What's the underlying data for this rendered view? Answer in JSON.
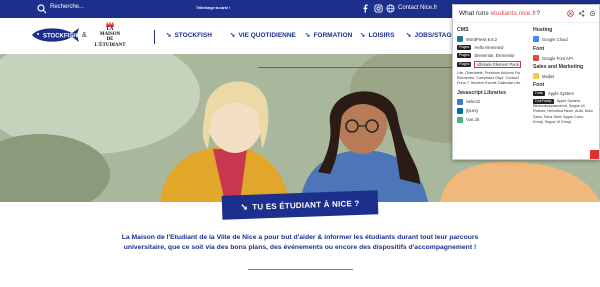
{
  "topbar": {
    "search_label": "Recherche...",
    "promo": "Télécharge ta carte !",
    "contact": "Contact",
    "nicefr": "Nice.fr"
  },
  "header": {
    "logo_fish_text": "STOCKFISH",
    "logo_amp": "&",
    "logo_maison_lines": [
      "LA",
      "MAISON",
      "DE",
      "L'ÉTUDIANT"
    ],
    "nav": [
      {
        "label": "STOCKFISH"
      },
      {
        "label": "VIE QUOTIDIENNE"
      },
      {
        "label": "FORMATION"
      },
      {
        "label": "LOISIRS"
      },
      {
        "label": "JOBS/STAGES"
      }
    ]
  },
  "hero": {
    "cta": "TU ES ÉTUDIANT À NICE ?"
  },
  "intro": {
    "text": "La Maison de l'Etudiant de la Ville de Nice a pour but d'aider & informer les étudiants durant tout leur parcours universitaire, que ce soit via des bons plans, des événements ou encore des dispositifs d'accompagnement !"
  },
  "popup": {
    "title_prefix": "What runs",
    "title_domain": "etudiants.nice.fr",
    "title_suffix": "?",
    "left": {
      "cms_heading": "CMS",
      "cms_wp": "WordPress 6.8.2",
      "plugin_tag_1": "Plugins",
      "plugin_hello": "Hello elementor",
      "plugin_tag_2": "Plugins",
      "plugin_elementor": "Elementor, Elementor",
      "plugin_tag_3": "Plugins",
      "plugin_ultimate": "Ultimate Element Pack",
      "plugin_list": "Lite, Orientable, Premium Addons For Elementor, Complianz Gdpr, Contact Form 7, Modern Events Calendar Lite",
      "js_heading": "Javascript Libraries",
      "js_select2": "Select2",
      "js_jquery": "jQuery",
      "js_vue": "Vue.JS"
    },
    "right": {
      "hosting_heading": "Hosting",
      "hosting_google": "Google Cloud",
      "font_heading_1": "Font",
      "font_google": "Google Font API",
      "sales_heading": "Sales and Marketing",
      "sales_mailjet": "Mailjet",
      "font_heading_2": "Font",
      "font_tag_1": "Fonts",
      "font_apple": "Apple System",
      "font_tag_2": "Font Family",
      "font_family_list": "Apple System, Blinkmacsystemfont, Segoe Ui, Roboto, Helvetica Neue, Arial, Noto Sans, Sans Serif, Apple Color Emoji, Segoe Ui Emoji"
    }
  },
  "colors": {
    "brand_blue": "#1c2f8c",
    "accent_red": "#e5484d"
  }
}
